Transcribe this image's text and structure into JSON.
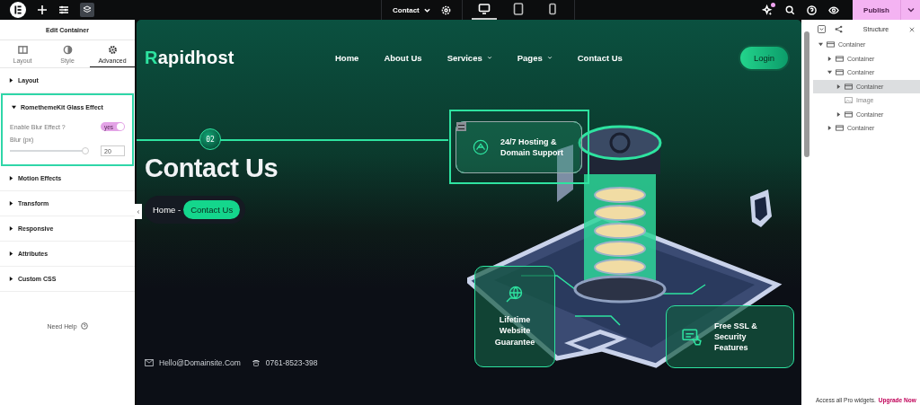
{
  "topbar": {
    "page": "Contact",
    "devices": [
      {
        "kind": "desktop",
        "selected": true
      },
      {
        "kind": "tablet",
        "selected": false
      },
      {
        "kind": "mobile",
        "selected": false
      }
    ],
    "notification": true,
    "publish": "Publish"
  },
  "panel": {
    "title": "Edit Container",
    "tabs": [
      {
        "kind": "layout",
        "label": "Layout",
        "selected": false
      },
      {
        "kind": "style",
        "label": "Style",
        "selected": false
      },
      {
        "kind": "advanced",
        "label": "Advanced",
        "selected": true
      }
    ],
    "sections": [
      {
        "label": "Layout",
        "expanded": false
      },
      {
        "label": "RomethemeKit Glass Effect",
        "expanded": true,
        "highlighted": true,
        "toggle": {
          "label": "Enable Blur Effect ?",
          "on": true,
          "text": "yes"
        },
        "slider": {
          "label": "Blur (px)",
          "level": 0.97,
          "value": "20"
        }
      },
      {
        "label": "Motion Effects",
        "expanded": false
      },
      {
        "label": "Transform",
        "expanded": false
      },
      {
        "label": "Responsive",
        "expanded": false
      },
      {
        "label": "Attributes",
        "expanded": false
      },
      {
        "label": "Custom CSS",
        "expanded": false
      }
    ],
    "help": "Need Help"
  },
  "site": {
    "logo": "Rapidhost",
    "nav": [
      {
        "label": "Home",
        "dropdown": false
      },
      {
        "label": "About Us",
        "dropdown": false
      },
      {
        "label": "Services",
        "dropdown": true
      },
      {
        "label": "Pages",
        "dropdown": true
      },
      {
        "label": "Contact Us",
        "dropdown": false
      }
    ],
    "login": "Login",
    "step": "02",
    "heading": "Contact Us",
    "breadcrumb": [
      {
        "label": "Home -",
        "selected": false
      },
      {
        "label": "Contact Us",
        "selected": true
      }
    ],
    "cards": [
      {
        "kind": "support",
        "text": "24/7 Hosting & Domain Support",
        "selected": true
      },
      {
        "kind": "globe",
        "text": "Lifetime Website Guarantee",
        "selected": false
      },
      {
        "kind": "security",
        "text": "Free SSL & Security Features",
        "selected": false
      }
    ],
    "contacts": [
      {
        "kind": "email",
        "text": "Hello@Domainsite.Com"
      },
      {
        "kind": "phone",
        "text": "0761-8523-398"
      }
    ]
  },
  "structure": {
    "title": "Structure",
    "tree": [
      {
        "kind": "container",
        "label": "Container",
        "expanded": true,
        "selected": false,
        "children": [
          {
            "kind": "container",
            "label": "Container",
            "expanded": false,
            "selected": false
          },
          {
            "kind": "container",
            "label": "Container",
            "expanded": true,
            "selected": false,
            "children": [
              {
                "kind": "container",
                "label": "Container",
                "expanded": false,
                "selected": true
              },
              {
                "kind": "image",
                "label": "Image",
                "selected": false
              },
              {
                "kind": "container",
                "label": "Container",
                "expanded": false,
                "selected": false
              }
            ]
          },
          {
            "kind": "container",
            "label": "Container",
            "expanded": false,
            "selected": false
          }
        ]
      }
    ]
  },
  "footer": {
    "text": "Access all Pro widgets.",
    "link": "Upgrade Now"
  }
}
